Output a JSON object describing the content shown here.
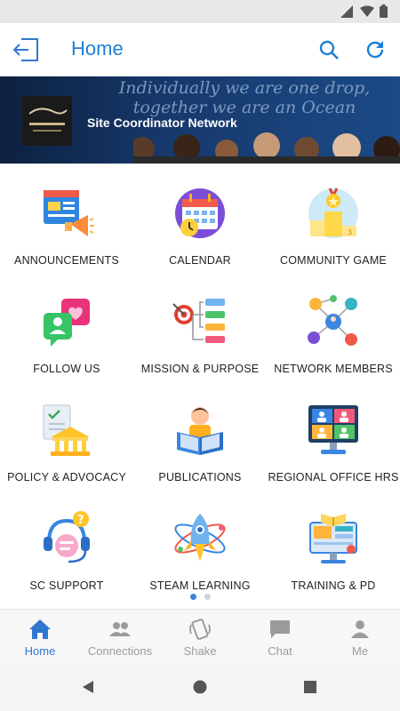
{
  "status_bar": {
    "icons": [
      "wifi-icon",
      "signal-icon",
      "battery-icon"
    ]
  },
  "header": {
    "title": "Home",
    "back_icon": "exit-icon",
    "actions": [
      "search-icon",
      "refresh-icon"
    ]
  },
  "banner": {
    "quote": "Individually we are one drop, together we are an Ocean",
    "network_name": "Site Coordinator Network"
  },
  "grid": {
    "items": [
      {
        "label": "ANNOUNCEMENTS",
        "icon": "announcements-icon"
      },
      {
        "label": "CALENDAR",
        "icon": "calendar-icon"
      },
      {
        "label": "COMMUNITY GAME",
        "icon": "trophy-podium-icon"
      },
      {
        "label": "FOLLOW US",
        "icon": "social-hearts-icon"
      },
      {
        "label": "MISSION & PURPOSE",
        "icon": "target-icon"
      },
      {
        "label": "NETWORK MEMBERS",
        "icon": "network-people-icon"
      },
      {
        "label": "POLICY & ADVOCACY",
        "icon": "policy-building-icon"
      },
      {
        "label": "PUBLICATIONS",
        "icon": "reader-book-icon"
      },
      {
        "label": "REGIONAL OFFICE HRS",
        "icon": "video-meeting-icon"
      },
      {
        "label": "SC SUPPORT",
        "icon": "headset-support-icon"
      },
      {
        "label": "STEAM LEARNING",
        "icon": "rocket-atom-icon"
      },
      {
        "label": "TRAINING & PD",
        "icon": "training-screen-icon"
      }
    ]
  },
  "pager": {
    "pages": 2,
    "current": 1
  },
  "tabs": [
    {
      "label": "Home",
      "icon": "home-icon",
      "active": true
    },
    {
      "label": "Connections",
      "icon": "people-icon",
      "active": false
    },
    {
      "label": "Shake",
      "icon": "shake-phone-icon",
      "active": false
    },
    {
      "label": "Chat",
      "icon": "chat-icon",
      "active": false
    },
    {
      "label": "Me",
      "icon": "person-icon",
      "active": false
    }
  ],
  "colors": {
    "accent": "#1e7fd6",
    "tab_active": "#2f78d0",
    "tab_inactive": "#9b9b9b"
  }
}
